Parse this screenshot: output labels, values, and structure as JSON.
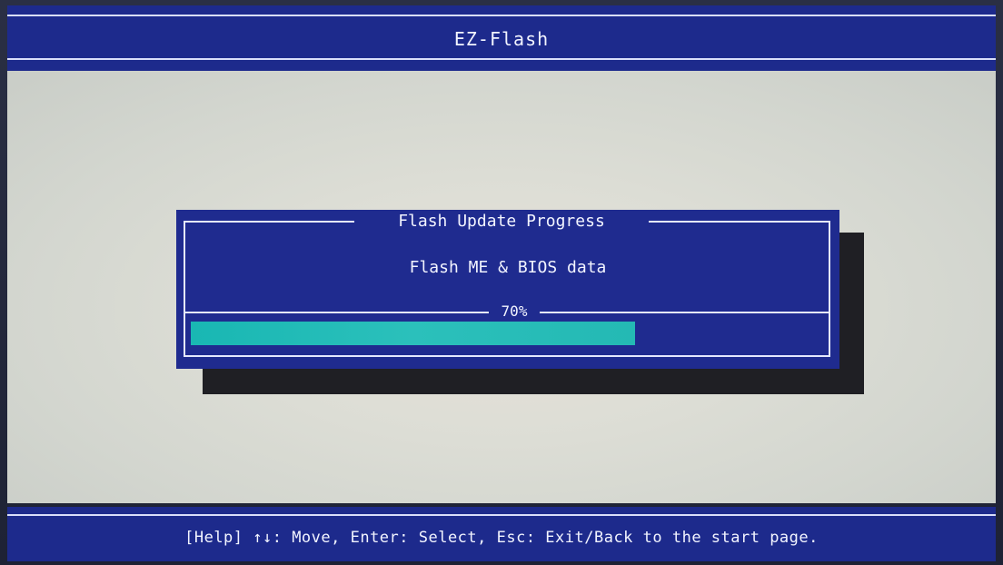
{
  "app": {
    "title": "EZ-Flash"
  },
  "dialog": {
    "title": "Flash Update Progress",
    "message": "Flash ME & BIOS data",
    "progress_label": "70%",
    "progress_value": 0.7
  },
  "statusbar": {
    "help_text": "[Help] ↑↓: Move, Enter: Select, Esc: Exit/Back to the start page."
  },
  "colors": {
    "bios_blue": "#1d2a8c",
    "progress_fill": "#19b7b3",
    "frame_line": "#e4e8ff"
  }
}
